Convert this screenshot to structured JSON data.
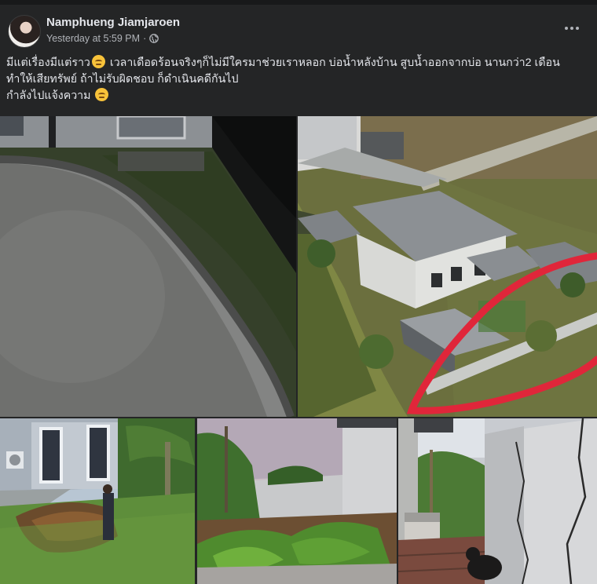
{
  "post": {
    "author": "Namphueng Jiamjaroen",
    "timestamp": "Yesterday at 5:59 PM",
    "separator": "·",
    "privacy_icon": "globe-icon",
    "more_icon": "more-options-icon",
    "text_lines": [
      "มีแต่เรื่องมีแต่ราว",
      "เวลาเดือดร้อนจริงๆก็ไม่มีใครมาช่วยเราหลอก บ่อน้ำหลังบ้าน สูบน้ำออกจากบ่อ นานกว่า2 เดือน",
      "ทำให้เสียทรัพย์ ถ้าไม่รับผิดชอบ ก็ดำเนินคดีกันไป",
      "กำลังไปแจ้งความ"
    ],
    "emoji": "disappointed-face-emoji"
  },
  "colors": {
    "background": "#242526",
    "text": "#e4e6eb",
    "meta": "#b0b3b8",
    "annotation": "#e0263a"
  }
}
